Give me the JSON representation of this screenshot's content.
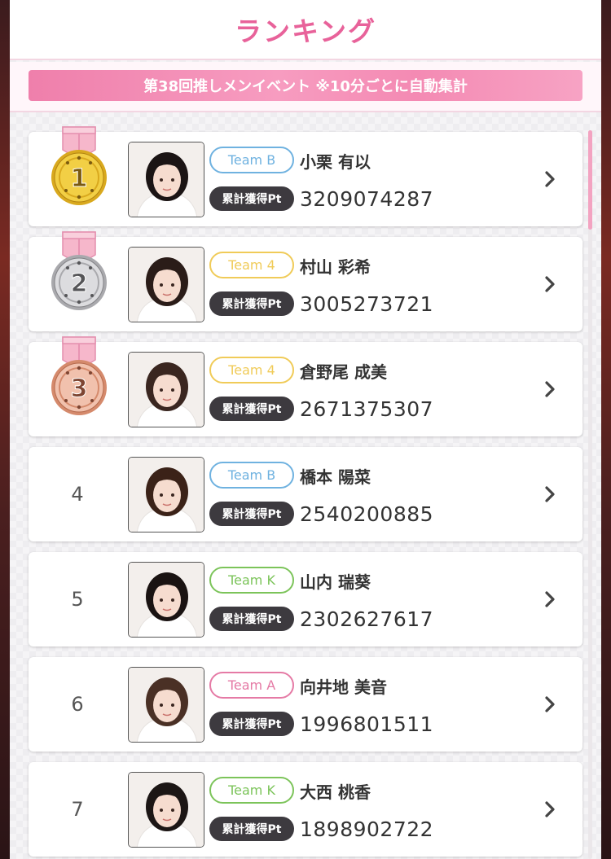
{
  "header": {
    "title": "ランキング"
  },
  "event_banner": {
    "text": "第38回推しメンイベント ※10分ごとに自動集計"
  },
  "pt_label": "累計獲得Pt",
  "colors": {
    "accent_pink": "#e8629a",
    "team_b": "#6fb2e0",
    "team_4": "#f0cb58",
    "team_k": "#7cc45a",
    "team_a": "#e57aa5",
    "gold": "#f2cf45",
    "silver": "#c9c9cc",
    "bronze": "#e8a48a"
  },
  "rankings": [
    {
      "rank": "1",
      "medal": "gold-medal-icon",
      "team": "Team B",
      "team_color": "#6fb2e0",
      "name": "小栗 有以",
      "points": "3209074287"
    },
    {
      "rank": "2",
      "medal": "silver-medal-icon",
      "team": "Team 4",
      "team_color": "#f0cb58",
      "name": "村山 彩希",
      "points": "3005273721"
    },
    {
      "rank": "3",
      "medal": "bronze-medal-icon",
      "team": "Team 4",
      "team_color": "#f0cb58",
      "name": "倉野尾 成美",
      "points": "2671375307"
    },
    {
      "rank": "4",
      "medal": "",
      "team": "Team B",
      "team_color": "#6fb2e0",
      "name": "橋本 陽菜",
      "points": "2540200885"
    },
    {
      "rank": "5",
      "medal": "",
      "team": "Team K",
      "team_color": "#7cc45a",
      "name": "山内 瑞葵",
      "points": "2302627617"
    },
    {
      "rank": "6",
      "medal": "",
      "team": "Team A",
      "team_color": "#e57aa5",
      "name": "向井地 美音",
      "points": "1996801511"
    },
    {
      "rank": "7",
      "medal": "",
      "team": "Team K",
      "team_color": "#7cc45a",
      "name": "大西 桃香",
      "points": "1898902722"
    }
  ],
  "scroll": {
    "position_fraction": 0.0
  }
}
